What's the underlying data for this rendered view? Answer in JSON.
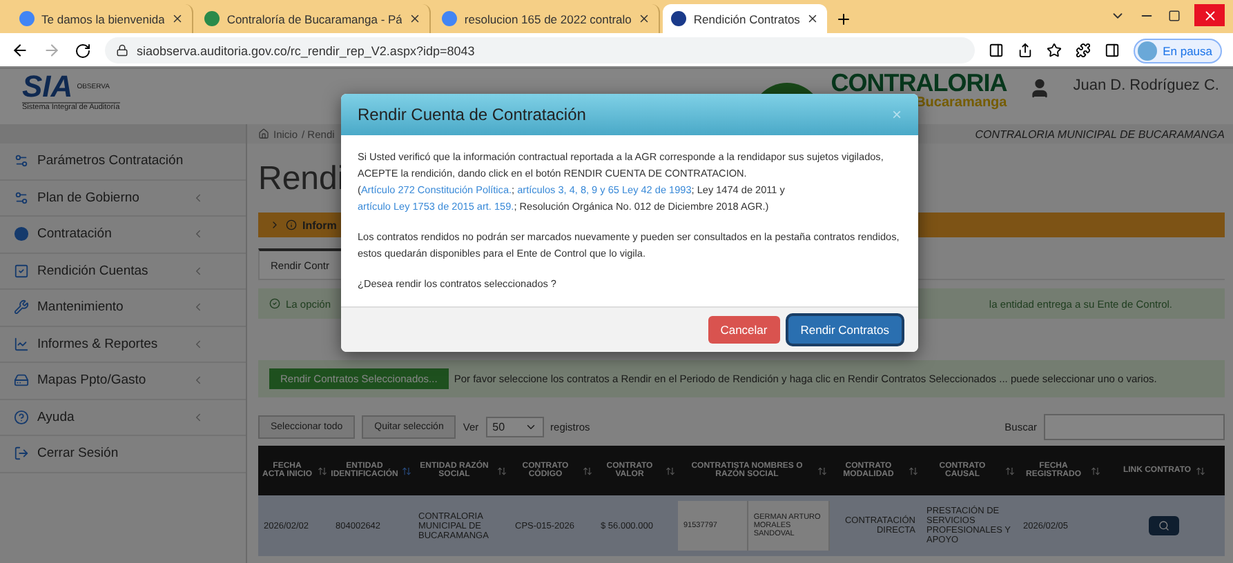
{
  "browser": {
    "tabs": [
      {
        "label": "Te damos la bienvenida",
        "selected": false,
        "kind": "google"
      },
      {
        "label": "Contraloría de Bucaramanga - Pá",
        "selected": false,
        "kind": "site"
      },
      {
        "label": "resolucion 165 de 2022 contralo",
        "selected": false,
        "kind": "google"
      },
      {
        "label": "Rendición Contratos",
        "selected": true,
        "kind": "sia"
      }
    ],
    "url": "siaobserva.auditoria.gov.co/rc_rendir_rep_V2.aspx?idp=8043",
    "profile": "En pausa"
  },
  "header": {
    "logo": "SIA",
    "logo_sub": "OBSERVA",
    "tagline": "Sistema Integral de Auditoría",
    "org": "CONTRALORIA",
    "city": "Bucaramanga",
    "user": "Juan D. Rodríguez C."
  },
  "breadcrumb": {
    "home": "Inicio",
    "current": "/ Rendi"
  },
  "entity": "CONTRALORIA MUNICIPAL DE BUCARAMANGA",
  "sidebar": {
    "items": [
      {
        "label": "Parámetros Contratación",
        "submenu": false
      },
      {
        "label": "Plan de Gobierno",
        "submenu": true
      },
      {
        "label": "Contratación",
        "submenu": true
      },
      {
        "label": "Rendición Cuentas",
        "submenu": true
      },
      {
        "label": "Mantenimiento",
        "submenu": true
      },
      {
        "label": "Informes & Reportes",
        "submenu": true
      },
      {
        "label": "Mapas Ppto/Gasto",
        "submenu": true
      },
      {
        "label": "Ayuda",
        "submenu": true
      },
      {
        "label": "Cerrar Sesión",
        "submenu": false
      }
    ]
  },
  "main": {
    "title": "Rendi",
    "info_bar": "Inform",
    "tab": "Rendir Contr",
    "alert_left": "La opción",
    "alert_right": "la entidad entrega a su Ente de Control.",
    "action_button": "Rendir Contratos Seleccionados...",
    "action_text": "Por favor seleccione los contratos a Rendir en el Periodo de Rendición y haga clic en Rendir Contratos Seleccionados ... puede seleccionar uno o varios.",
    "select_all": "Seleccionar todo",
    "clear_selection": "Quitar selección",
    "show_label": "Ver",
    "page_size": "50",
    "records_label": "registros",
    "search_label": "Buscar"
  },
  "table": {
    "columns": [
      {
        "label": "FECHA ACTA INICIO",
        "sorted": false
      },
      {
        "label": "ENTIDAD IDENTIFICACIÓN",
        "sorted": true
      },
      {
        "label": "ENTIDAD RAZÓN SOCIAL",
        "sorted": false
      },
      {
        "label": "CONTRATO CÓDIGO",
        "sorted": false
      },
      {
        "label": "CONTRATO VALOR",
        "sorted": false
      },
      {
        "label": "CONTRATISTA NOMBRES O RAZÓN SOCIAL",
        "sorted": false
      },
      {
        "label": "CONTRATO MODALIDAD",
        "sorted": false
      },
      {
        "label": "CONTRATO CAUSAL",
        "sorted": false
      },
      {
        "label": "FECHA REGISTRADO",
        "sorted": false
      },
      {
        "label": "LINK CONTRATO",
        "sorted": false
      }
    ],
    "rows": [
      {
        "fecha_acta": "2026/02/02",
        "entidad_id": "804002642",
        "entidad_razon": "CONTRALORIA MUNICIPAL DE BUCARAMANGA",
        "codigo": "CPS-015-2026",
        "valor": "$ 56.000.000",
        "contratista_id": "91537797",
        "contratista_nombre": "GERMAN ARTURO MORALES SANDOVAL",
        "modalidad": "CONTRATACIÓN DIRECTA",
        "causal": "PRESTACIÓN DE SERVICIOS PROFESIONALES Y APOYO",
        "fecha_registrado": "2026/02/05"
      }
    ]
  },
  "modal": {
    "title": "Rendir Cuenta de Contratación",
    "close": "×",
    "intro": [
      {
        "text": "Si Usted verificó que la información contractual reportada a la AGR corresponde a la rendidapor sus sujetos vigilados, ACEPTE la rendición, dando click en el botón RENDIR CUENTA DE CONTRATACION. (",
        "link": false
      },
      {
        "text": "Artículo 272 Constitución Política.",
        "link": true
      },
      {
        "text": "; ",
        "link": false
      },
      {
        "text": "artículos 3, 4, 8, 9 y 65 Ley 42 de 1993",
        "link": true
      },
      {
        "text": "; Ley 1474 de 2011 y ",
        "link": false
      },
      {
        "text": "artículo Ley 1753 de 2015 art. 159.",
        "link": true
      },
      {
        "text": "; Resolución Orgánica No. 012 de Diciembre 2018 AGR.)",
        "link": false
      }
    ],
    "note": "Los contratos rendidos no podrán ser marcados nuevamente y pueden ser consultados en la pestaña contratos rendidos, estos quedarán disponibles para el Ente de Control que lo vigila.",
    "question": "¿Desea rendir los contratos seleccionados ?",
    "buttons": [
      {
        "label": "Cancelar",
        "kind": "danger"
      },
      {
        "label": "Rendir Contratos",
        "kind": "primary"
      }
    ]
  }
}
